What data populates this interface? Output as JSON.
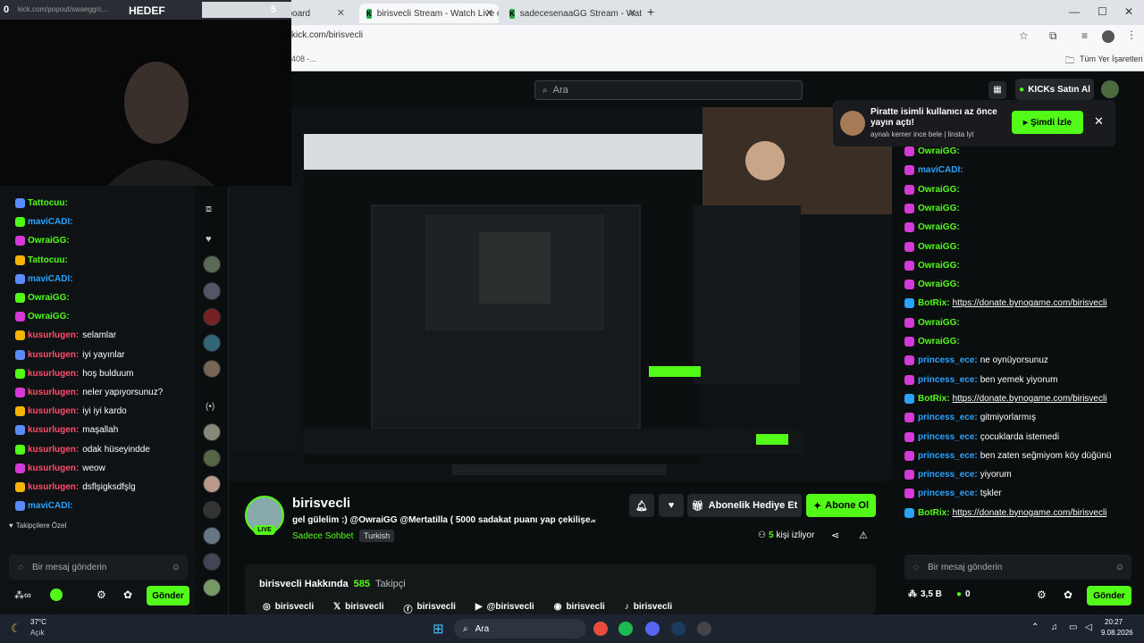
{
  "browser": {
    "tabs": [
      {
        "label": "kick.com/popout/swaegg/c...",
        "close": "✕"
      },
      {
        "label": "Stream - Dashboard",
        "close": "✕"
      },
      {
        "label": "birisvecli Stream - Watch Live o",
        "close": "✕"
      },
      {
        "label": "sadecesenaaGG Stream - Watc",
        "close": "✕"
      }
    ],
    "new_tab": "+",
    "url": "kick.com/birisvecli",
    "bookmark_frag": "408 -...",
    "bookmarks_folder": "Tüm Yer İşaretleri"
  },
  "webcam": {
    "overlay_label": "HEDEF",
    "counter": "5",
    "corner_digit": "0"
  },
  "left_chat": {
    "messages": [
      {
        "user": "Tattocuu:",
        "text": "",
        "color": "#53fc18"
      },
      {
        "user": "maviCADI:",
        "text": "",
        "color": "#2aa3ff"
      },
      {
        "user": "OwraiGG:",
        "text": "",
        "color": "#53fc18"
      },
      {
        "user": "Tattocuu:",
        "text": "",
        "color": "#53fc18"
      },
      {
        "user": "maviCADI:",
        "text": "",
        "color": "#2aa3ff"
      },
      {
        "user": "OwraiGG:",
        "text": "",
        "color": "#53fc18"
      },
      {
        "user": "OwraiGG:",
        "text": "",
        "color": "#53fc18"
      },
      {
        "user": "kusurlugen:",
        "text": "selamlar",
        "color": "#ff4d6d"
      },
      {
        "user": "kusurlugen:",
        "text": "iyi yayınlar",
        "color": "#ff4d6d"
      },
      {
        "user": "kusurlugen:",
        "text": "hoş bulduum",
        "color": "#ff4d6d"
      },
      {
        "user": "kusurlugen:",
        "text": "neler yapıyorsunuz?",
        "color": "#ff4d6d"
      },
      {
        "user": "kusurlugen:",
        "text": "iyi iyi kardo",
        "color": "#ff4d6d"
      },
      {
        "user": "kusurlugen:",
        "text": "maşallah",
        "color": "#ff4d6d"
      },
      {
        "user": "kusurlugen:",
        "text": "odak hüseyindde",
        "color": "#ff4d6d"
      },
      {
        "user": "kusurlugen:",
        "text": "weow",
        "color": "#ff4d6d"
      },
      {
        "user": "kusurlugen:",
        "text": "dsflşigksdfşlg",
        "color": "#ff4d6d"
      },
      {
        "user": "maviCADI:",
        "text": "",
        "color": "#2aa3ff"
      }
    ],
    "followers_label": "Takipçilere Özel",
    "input_placeholder": "Bir mesaj gönderin",
    "send": "Gönder"
  },
  "site": {
    "search_placeholder": "Ara",
    "buy_kicks": "KICKs Satın Al"
  },
  "notification": {
    "title": "Piratte isimli kullanıcı az önce yayın açtı!",
    "subtitle": "aynalı kemer ince bele | linsta lyt",
    "watch": "Şimdi İzle"
  },
  "channel": {
    "name": "birisvecli",
    "title": "gel gülelim :) @OwraiGG @Mertatilla ( 5000 sadakat puanı yap çekilişe...",
    "category": "Sadece Sohbet",
    "tag": "Turkish",
    "live": "LIVE",
    "gift": "Abonelik Hediye Et",
    "subscribe": "Abone Ol",
    "viewers": "5",
    "viewers_label": "kişi izliyor",
    "about": "birisvecli Hakkında",
    "followers": "585",
    "followers_label": "Takipçi",
    "socials": [
      {
        "icon": "instagram-icon",
        "glyph": "◎",
        "label": "birisvecli"
      },
      {
        "icon": "x-icon",
        "glyph": "𝕏",
        "label": "birisvecli"
      },
      {
        "icon": "facebook-icon",
        "glyph": "ⓕ",
        "label": "birisvecli"
      },
      {
        "icon": "youtube-icon",
        "glyph": "▶",
        "label": "@birisvecli"
      },
      {
        "icon": "discord-icon",
        "glyph": "◉",
        "label": "birisvecli"
      },
      {
        "icon": "tiktok-icon",
        "glyph": "♪",
        "label": "birisvecli"
      }
    ]
  },
  "right_chat": {
    "messages": [
      {
        "user": "OwraiGG:",
        "text": "",
        "color": "#53fc18",
        "link": false
      },
      {
        "user": "maviCADI:",
        "text": "",
        "color": "#2aa3ff",
        "link": false
      },
      {
        "user": "OwraiGG:",
        "text": "",
        "color": "#53fc18",
        "link": false
      },
      {
        "user": "OwraiGG:",
        "text": "",
        "color": "#53fc18",
        "link": false
      },
      {
        "user": "OwraiGG:",
        "text": "",
        "color": "#53fc18",
        "link": false
      },
      {
        "user": "OwraiGG:",
        "text": "",
        "color": "#53fc18",
        "link": false
      },
      {
        "user": "OwraiGG:",
        "text": "",
        "color": "#53fc18",
        "link": false
      },
      {
        "user": "OwraiGG:",
        "text": "",
        "color": "#53fc18",
        "link": false
      },
      {
        "user": "BotRix:",
        "text": "https://donate.bynogame.com/birisvecli",
        "color": "#53fc18",
        "link": true
      },
      {
        "user": "OwraiGG:",
        "text": "",
        "color": "#53fc18",
        "link": false
      },
      {
        "user": "OwraiGG:",
        "text": "",
        "color": "#53fc18",
        "link": false
      },
      {
        "user": "princess_ece:",
        "text": "ne oynüyorsunuz",
        "color": "#2aa3ff",
        "link": false
      },
      {
        "user": "princess_ece:",
        "text": "ben yemek yiyorum",
        "color": "#2aa3ff",
        "link": false
      },
      {
        "user": "BotRix:",
        "text": "https://donate.bynogame.com/birisvecli",
        "color": "#53fc18",
        "link": true
      },
      {
        "user": "princess_ece:",
        "text": "gitmiyorlarmış",
        "color": "#2aa3ff",
        "link": false
      },
      {
        "user": "princess_ece:",
        "text": "çocuklarda istemedi",
        "color": "#2aa3ff",
        "link": false
      },
      {
        "user": "princess_ece:",
        "text": "ben zaten seğmiyom köy düğünü",
        "color": "#2aa3ff",
        "link": false
      },
      {
        "user": "princess_ece:",
        "text": "yiyorum",
        "color": "#2aa3ff",
        "link": false
      },
      {
        "user": "princess_ece:",
        "text": "tşkler",
        "color": "#2aa3ff",
        "link": false
      },
      {
        "user": "BotRix:",
        "text": "https://donate.bynogame.com/birisvecli",
        "color": "#53fc18",
        "link": true
      }
    ],
    "input_placeholder": "Bir mesaj gönderin",
    "points": "3,5 B",
    "kicks": "0",
    "send": "Gönder"
  },
  "taskbar": {
    "weather_temp": "37°C",
    "weather_desc": "Açık",
    "search": "Ara",
    "time": "20:27",
    "date": "9.08.2026"
  },
  "colors": {
    "accent": "#53fc18",
    "bg": "#0b0e0f",
    "panel": "#191b1f"
  }
}
